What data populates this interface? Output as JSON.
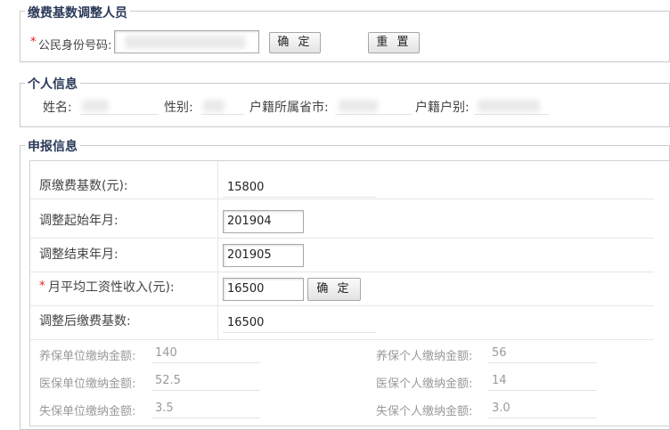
{
  "section1": {
    "legend": "缴费基数调整人员",
    "id_label": "公民身份号码:",
    "required_mark": "*",
    "confirm": "确 定",
    "reset": "重 置"
  },
  "section2": {
    "legend": "个人信息",
    "name_label": "姓名:",
    "gender_label": "性别:",
    "province_label": "户籍所属省市:",
    "huji_type_label": "户籍户别:"
  },
  "section3": {
    "legend": "申报信息",
    "orig_base_label": "原缴费基数(元):",
    "orig_base_value": "15800",
    "start_label": "调整起始年月:",
    "start_value": "201904",
    "end_label": "调整结束年月:",
    "end_value": "201905",
    "income_required": "*",
    "income_label": "月平均工资性收入(元):",
    "income_value": "16500",
    "income_confirm": "确 定",
    "new_base_label": "调整后缴费基数:",
    "new_base_value": "16500",
    "pension_unit_label": "养保单位缴纳金额:",
    "pension_unit_value": "140",
    "pension_person_label": "养保个人缴纳金额:",
    "pension_person_value": "56",
    "medical_unit_label": "医保单位缴纳金额:",
    "medical_unit_value": "52.5",
    "medical_person_label": "医保个人缴纳金额:",
    "medical_person_value": "14",
    "unemp_unit_label": "失保单位缴纳金额:",
    "unemp_unit_value": "3.5",
    "unemp_person_label": "失保个人缴纳金额:",
    "unemp_person_value": "3.0"
  }
}
